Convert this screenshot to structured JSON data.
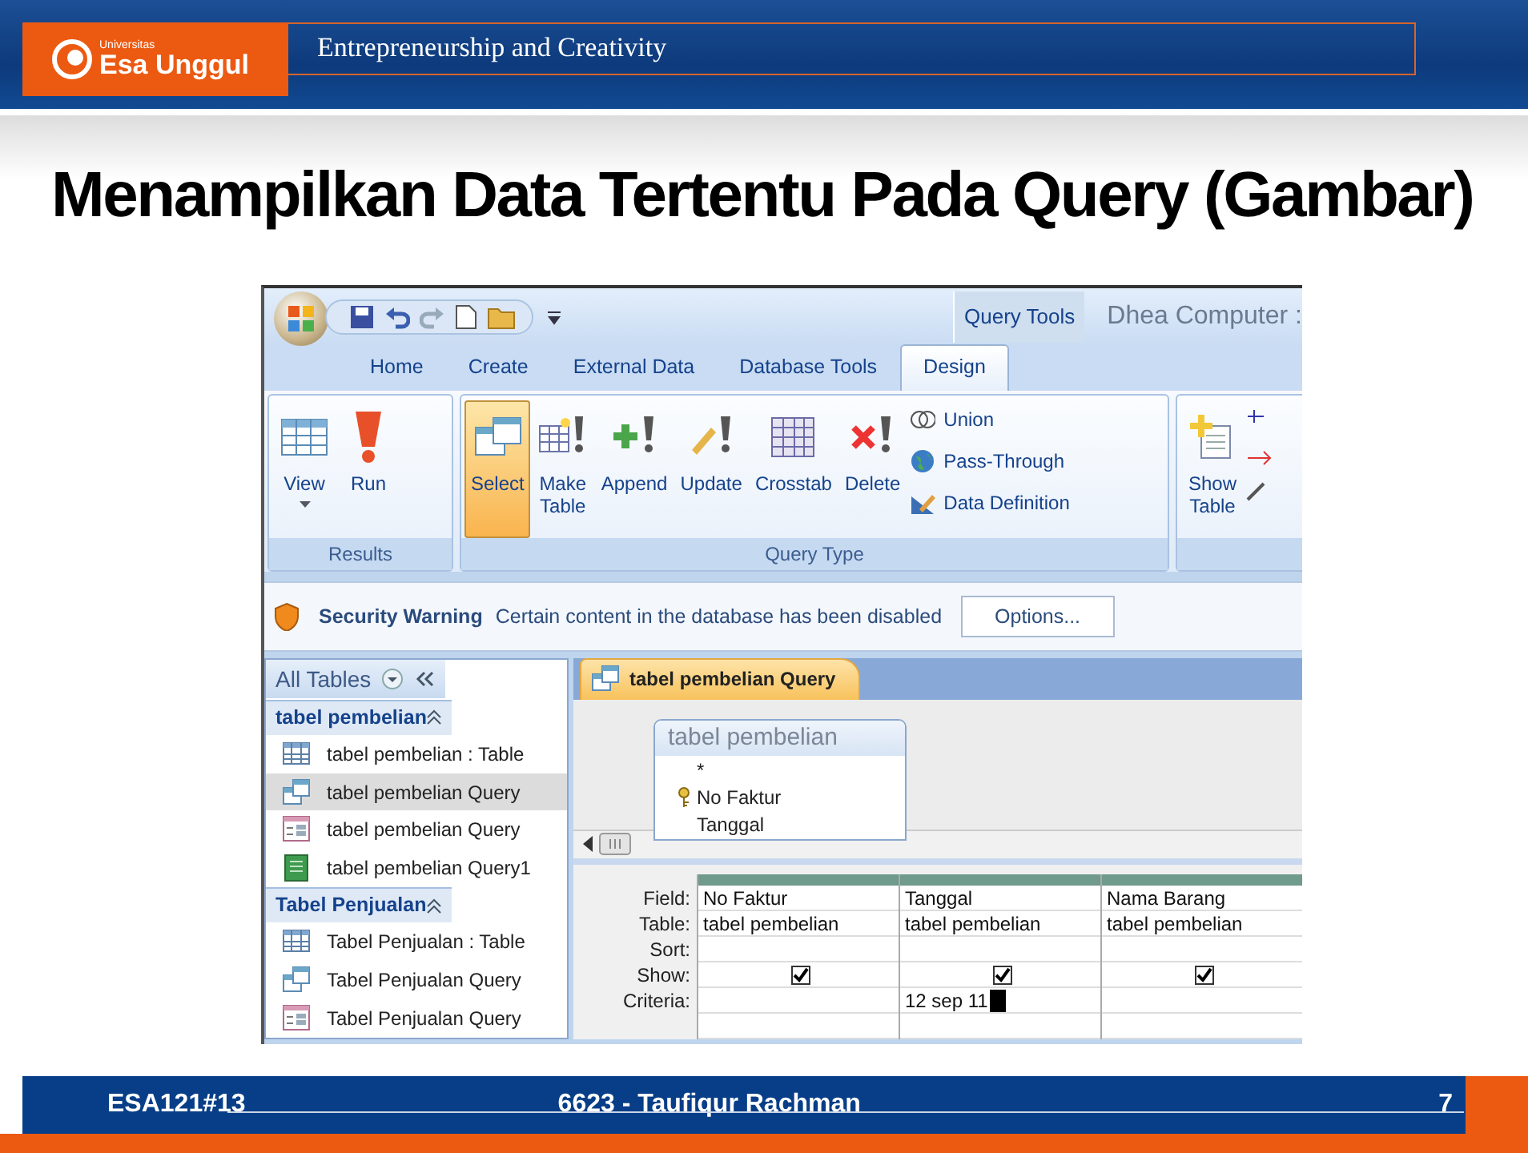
{
  "slide": {
    "logo": {
      "caption": "Universitas",
      "name": "Esa Unggul"
    },
    "header_title": "Entrepreneurship and Creativity",
    "title": "Menampilkan Data Tertentu Pada Query (Gambar)",
    "footer": {
      "course": "ESA121",
      "session": "#13",
      "author": "6623 - Taufiqur Rachman",
      "page": "7"
    }
  },
  "window": {
    "context_tab": "Query Tools",
    "title": "Dhea Computer :"
  },
  "tabs": [
    {
      "label": "Home",
      "selected": false
    },
    {
      "label": "Create",
      "selected": false
    },
    {
      "label": "External Data",
      "selected": false
    },
    {
      "label": "Database Tools",
      "selected": false
    },
    {
      "label": "Design",
      "selected": true
    }
  ],
  "ribbon": {
    "groups": [
      {
        "label": "Results",
        "buttons": [
          {
            "label": "View",
            "dropdown": true,
            "selected": false
          },
          {
            "label": "Run",
            "dropdown": false,
            "selected": false
          }
        ]
      },
      {
        "label": "Query Type",
        "buttons": [
          {
            "label": "Select",
            "dropdown": false,
            "selected": true
          },
          {
            "label": "Make Table",
            "dropdown": false,
            "selected": false
          },
          {
            "label": "Append",
            "dropdown": false,
            "selected": false
          },
          {
            "label": "Update",
            "dropdown": false,
            "selected": false
          },
          {
            "label": "Crosstab",
            "dropdown": false,
            "selected": false
          },
          {
            "label": "Delete",
            "dropdown": false,
            "selected": false
          }
        ],
        "small_buttons": [
          {
            "label": "Union"
          },
          {
            "label": "Pass-Through"
          },
          {
            "label": "Data Definition"
          }
        ]
      },
      {
        "buttons": [
          {
            "label": "Show Table",
            "dropdown": false,
            "selected": false
          }
        ]
      }
    ]
  },
  "security_bar": {
    "title": "Security Warning",
    "message": "Certain content in the database has been disabled",
    "button": "Options..."
  },
  "navigation": {
    "header": "All Tables",
    "groups": [
      {
        "name": "tabel pembelian",
        "items": [
          {
            "label": "tabel pembelian : Table",
            "kind": "table",
            "selected": false
          },
          {
            "label": "tabel pembelian Query",
            "kind": "query",
            "selected": true
          },
          {
            "label": "tabel pembelian Query",
            "kind": "form",
            "selected": false
          },
          {
            "label": "tabel pembelian Query1",
            "kind": "report",
            "selected": false
          }
        ]
      },
      {
        "name": "Tabel Penjualan",
        "items": [
          {
            "label": "Tabel Penjualan : Table",
            "kind": "table",
            "selected": false
          },
          {
            "label": "Tabel Penjualan Query",
            "kind": "query",
            "selected": false
          },
          {
            "label": "Tabel Penjualan Query",
            "kind": "form",
            "selected": false
          }
        ]
      }
    ]
  },
  "document": {
    "tab": "tabel pembelian Query",
    "field_list": {
      "title": "tabel pembelian",
      "fields": [
        {
          "name": "*",
          "key": false
        },
        {
          "name": "No Faktur",
          "key": true
        },
        {
          "name": "Tanggal",
          "key": false
        }
      ]
    },
    "grid": {
      "row_labels": [
        "Field:",
        "Table:",
        "Sort:",
        "Show:",
        "Criteria:"
      ],
      "columns": [
        {
          "field": "No Faktur",
          "table": "tabel pembelian",
          "show": true
        },
        {
          "field": "Tanggal",
          "table": "tabel pembelian",
          "show": true,
          "criteria": "12 sep 11",
          "editing": true
        },
        {
          "field": "Nama Barang",
          "table": "tabel pembelian",
          "show": true
        }
      ]
    }
  }
}
